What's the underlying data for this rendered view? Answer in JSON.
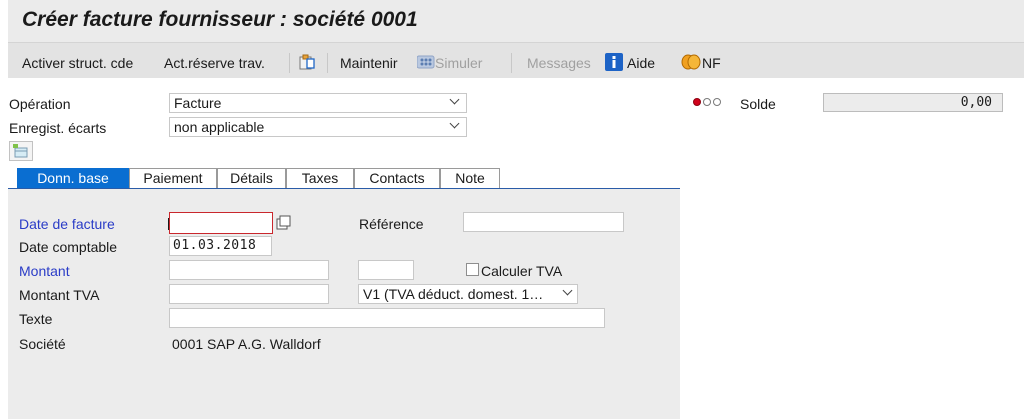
{
  "title": "Créer facture fournisseur : société 0001",
  "toolbar": {
    "activer_struct": "Activer struct. cde",
    "act_reserve": "Act.réserve trav.",
    "maintenir": "Maintenir",
    "simuler": "Simuler",
    "messages": "Messages",
    "aide": "Aide",
    "nf": "NF"
  },
  "header": {
    "operation_label": "Opération",
    "operation_value": "Facture",
    "enregist_label": "Enregist. écarts",
    "enregist_value": "non applicable",
    "solde_label": "Solde",
    "solde_value": "0,00"
  },
  "tabs": [
    {
      "label": "Donn. base",
      "active": true
    },
    {
      "label": "Paiement",
      "active": false
    },
    {
      "label": "Détails",
      "active": false
    },
    {
      "label": "Taxes",
      "active": false
    },
    {
      "label": "Contacts",
      "active": false
    },
    {
      "label": "Note",
      "active": false
    }
  ],
  "form": {
    "date_facture_label": "Date de facture",
    "date_facture_value": "",
    "reference_label": "Référence",
    "reference_value": "",
    "date_comptable_label": "Date comptable",
    "date_comptable_value": "01.03.2018",
    "montant_label": "Montant",
    "montant_value": "",
    "devise_value": "",
    "calculer_tva_label": "Calculer TVA",
    "calculer_tva_checked": false,
    "montant_tva_label": "Montant TVA",
    "montant_tva_value": "",
    "tax_code_value": "V1 (TVA déduct. domest. 1…",
    "texte_label": "Texte",
    "texte_value": "",
    "societe_label": "Société",
    "societe_value": "0001 SAP A.G. Walldorf"
  },
  "colors": {
    "active_tab": "#0a6ed1",
    "required_label": "#2a3cc7",
    "status_red": "#d0021b"
  }
}
